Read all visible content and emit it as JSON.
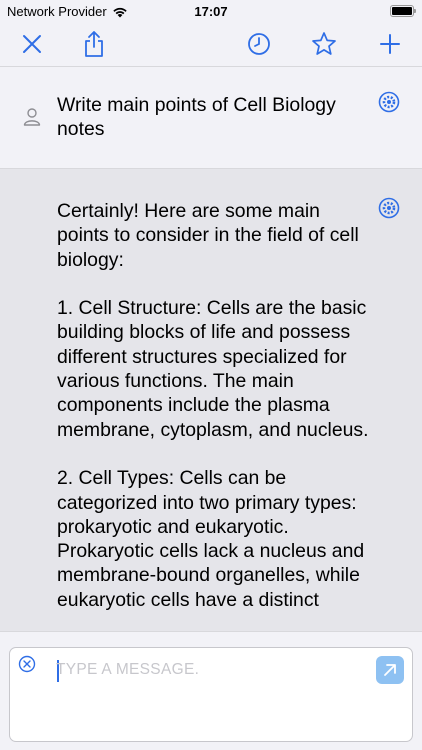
{
  "status_bar": {
    "carrier": "Network Provider",
    "time": "17:07"
  },
  "toolbar": {
    "close_icon": "close-icon",
    "share_icon": "share-icon",
    "history_icon": "clock-icon",
    "favorite_icon": "star-icon",
    "new_icon": "plus-icon"
  },
  "conversation": {
    "user_message": "Write main points of Cell Biology notes",
    "assistant_message": "Certainly! Here are some main points to consider in the field of cell biology:\n\n1. Cell Structure: Cells are the basic building blocks of life and possess different structures specialized for various functions. The main components include the plasma membrane, cytoplasm, and nucleus.\n\n2. Cell Types: Cells can be categorized into two primary types: prokaryotic and eukaryotic. Prokaryotic cells lack a nucleus and membrane-bound organelles, while eukaryotic cells have a distinct"
  },
  "composer": {
    "placeholder": "TYPE A MESSAGE.",
    "value": ""
  },
  "colors": {
    "accent": "#2f6ee6",
    "send_button": "#8ec1f2",
    "user_bg": "#f2f2f7",
    "assistant_bg": "#e5e5ea"
  }
}
